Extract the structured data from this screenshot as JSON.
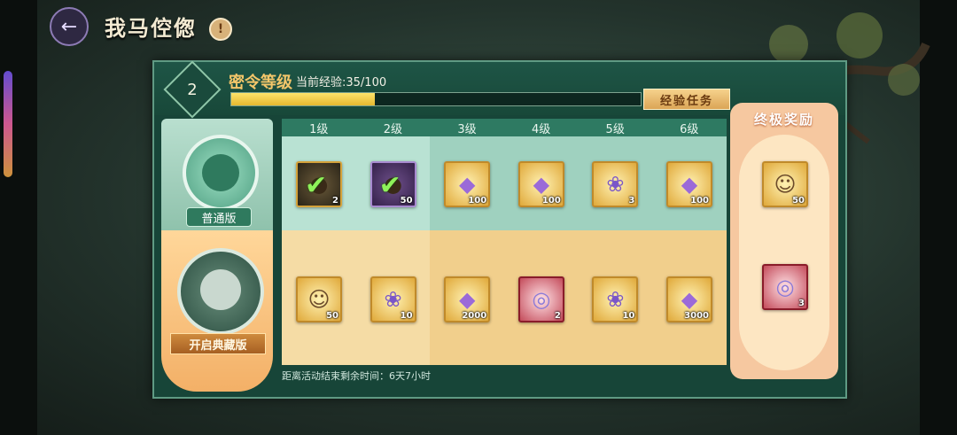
{
  "header": {
    "title": "我马倥偬",
    "info_icon": "!",
    "back_icon": "back-arrow-icon"
  },
  "pass": {
    "level": "2",
    "level_title": "密令等级",
    "exp_label": "当前经验:35/100",
    "exp_current": 35,
    "exp_max": 100,
    "exp_task_button": "经验任务"
  },
  "tracks": {
    "normal_label": "普通版",
    "collect_label": "开启典藏版"
  },
  "columns": [
    "1级",
    "2级",
    "3级",
    "4级",
    "5级",
    "6级"
  ],
  "normal_rewards": [
    {
      "icon": "pouch-icon",
      "qty": "2",
      "claimed": true,
      "style": "dark"
    },
    {
      "icon": "pouch-icon",
      "qty": "50",
      "claimed": true,
      "style": "purple"
    },
    {
      "icon": "crystal-icon",
      "qty": "100",
      "claimed": false,
      "style": "gold"
    },
    {
      "icon": "crystal-icon",
      "qty": "100",
      "claimed": false,
      "style": "gold"
    },
    {
      "icon": "dragon-scroll-icon",
      "qty": "3",
      "claimed": false,
      "style": "gold"
    },
    {
      "icon": "crystal-icon",
      "qty": "100",
      "claimed": false,
      "style": "gold"
    }
  ],
  "collect_rewards": [
    {
      "icon": "hero-portrait-icon",
      "qty": "50",
      "style": "gold"
    },
    {
      "icon": "dragon-scroll-icon",
      "qty": "10",
      "style": "gold"
    },
    {
      "icon": "crystal-icon",
      "qty": "2000",
      "style": "gold"
    },
    {
      "icon": "orb-icon",
      "qty": "2",
      "style": "red"
    },
    {
      "icon": "dragon-scroll-icon",
      "qty": "10",
      "style": "gold"
    },
    {
      "icon": "crystal-icon",
      "qty": "3000",
      "style": "gold"
    }
  ],
  "final": {
    "title": "终极奖励",
    "normal": {
      "icon": "hero-portrait-icon",
      "qty": "50",
      "style": "gold"
    },
    "collect": {
      "icon": "orb-icon",
      "qty": "3",
      "style": "red"
    }
  },
  "footer": "距离活动结束剩余时间：6天7小时",
  "colors": {
    "panel": "#174538",
    "accent_gold": "#f4c66a",
    "exp_fill": "#ffe36a"
  }
}
